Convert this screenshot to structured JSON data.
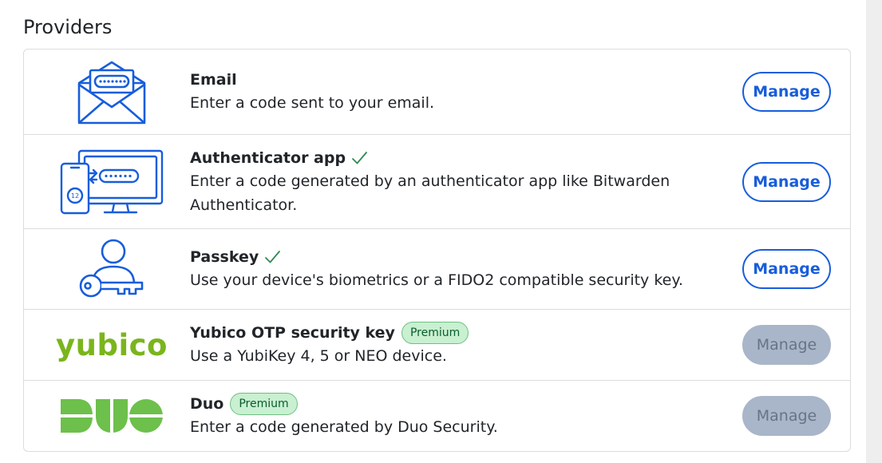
{
  "section": {
    "title": "Providers"
  },
  "colors": {
    "accent": "#175ddc",
    "check": "#2e8b57",
    "premium_bg": "#c8f0d1",
    "disabled_button": "#a9b5c9",
    "yubico_green": "#7ab51d",
    "duo_green": "#6dc04b"
  },
  "providers": [
    {
      "name": "Email",
      "description": "Enter a code sent to your email.",
      "icon": "envelope-code-icon",
      "enabled": false,
      "premium": false,
      "manage_label": "Manage"
    },
    {
      "name": "Authenticator app",
      "description": "Enter a code generated by an authenticator app like Bitwarden Authenticator.",
      "icon": "authenticator-devices-icon",
      "enabled": true,
      "premium": false,
      "manage_label": "Manage"
    },
    {
      "name": "Passkey",
      "description": "Use your device's biometrics or a FIDO2 compatible security key.",
      "icon": "user-key-icon",
      "enabled": true,
      "premium": false,
      "manage_label": "Manage"
    },
    {
      "name": "Yubico OTP security key",
      "description": "Use a YubiKey 4, 5 or NEO device.",
      "icon": "yubico-logo",
      "logo_text": "yubico",
      "enabled": false,
      "premium": true,
      "premium_label": "Premium",
      "manage_label": "Manage"
    },
    {
      "name": "Duo",
      "description": "Enter a code generated by Duo Security.",
      "icon": "duo-logo",
      "logo_text": "DUO",
      "enabled": false,
      "premium": true,
      "premium_label": "Premium",
      "manage_label": "Manage"
    }
  ]
}
